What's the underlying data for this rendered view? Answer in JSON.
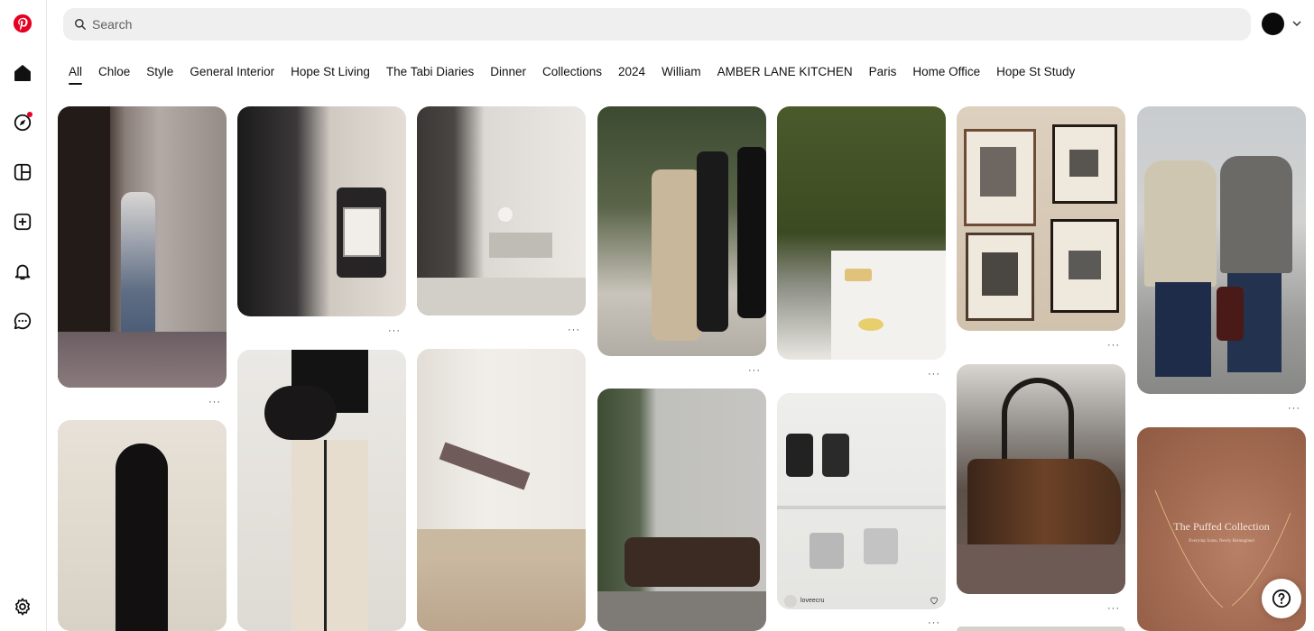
{
  "search": {
    "placeholder": "Search"
  },
  "tabs": [
    {
      "label": "All"
    },
    {
      "label": "Chloe"
    },
    {
      "label": "Style"
    },
    {
      "label": "General Interior"
    },
    {
      "label": "Hope St Living"
    },
    {
      "label": "The Tabi Diaries"
    },
    {
      "label": "Dinner"
    },
    {
      "label": "Collections"
    },
    {
      "label": "2024"
    },
    {
      "label": "William"
    },
    {
      "label": "AMBER LANE KITCHEN"
    },
    {
      "label": "Paris"
    },
    {
      "label": "Home Office"
    },
    {
      "label": "Hope St Study"
    }
  ],
  "more_glyph": "···",
  "pins": {
    "p8": {
      "account": "loveecru"
    },
    "p9": {
      "title": "The Puffed Collection",
      "subtitle": "Everyday Icons, Newly Reimagined"
    }
  },
  "colors": {
    "brand": "#e60023",
    "search_bg": "#efefef"
  }
}
